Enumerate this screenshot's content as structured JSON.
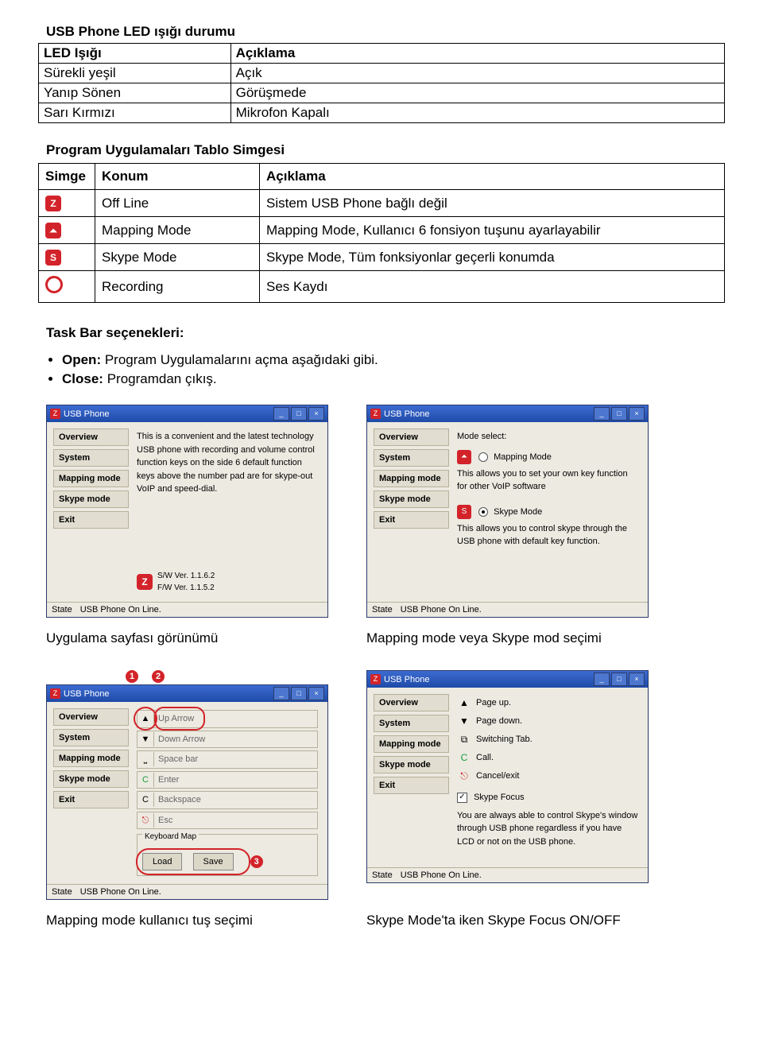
{
  "led_table": {
    "title": "USB Phone LED ışığı durumu",
    "header_left": "LED Işığı",
    "header_right": "Açıklama",
    "rows": [
      {
        "l": "Sürekli yeşil",
        "r": "Açık"
      },
      {
        "l": "Yanıp Sönen",
        "r": "Görüşmede"
      },
      {
        "l": "Sarı Kırmızı",
        "r": "Mikrofon Kapalı"
      }
    ]
  },
  "sim_table": {
    "title": "Program Uygulamaları Tablo Simgesi",
    "h1": "Simge",
    "h2": "Konum",
    "h3": "Açıklama",
    "rows": [
      {
        "icon": "Z",
        "konum": "Off Line",
        "acik": "Sistem USB Phone bağlı değil"
      },
      {
        "icon": "⏶",
        "konum": "Mapping Mode",
        "acik": "Mapping Mode, Kullanıcı 6 fonsiyon tuşunu ayarlayabilir"
      },
      {
        "icon": "S",
        "konum": "Skype Mode",
        "acik": "Skype Mode, Tüm fonksiyonlar geçerli konumda"
      },
      {
        "icon": "ring",
        "konum": "Recording",
        "acik": "Ses Kaydı"
      }
    ]
  },
  "task": {
    "title": "Task Bar seçenekleri:",
    "open_label": "Open:",
    "open_text": " Program Uygulamalarını açma aşağıdaki gibi.",
    "close_label": "Close:",
    "close_text": " Programdan çıkış."
  },
  "win_common": {
    "title": "USB Phone",
    "menu": [
      "Overview",
      "System",
      "Mapping mode",
      "Skype mode",
      "Exit"
    ],
    "state_label": "State",
    "state_value": "USB Phone On Line."
  },
  "shot1": {
    "overview_text": "This is a convenient and the latest technology USB phone with recording and volume control function keys on the side 6 default function keys above the number pad are for skype-out VoIP and speed-dial.",
    "sw_label": "S/W Ver.",
    "sw_value": "1.1.6.2",
    "fw_label": "F/W Ver.",
    "fw_value": "1.1.5.2"
  },
  "shot2": {
    "mode_select": "Mode select:",
    "mapping_label": "Mapping Mode",
    "mapping_desc": "This allows you to set your own key function for other VoIP software",
    "skype_label": "Skype Mode",
    "skype_desc": "This allows you to control skype through the USB phone with default key function."
  },
  "shot3": {
    "rows": [
      {
        "icon": "▲",
        "label": "Up Arrow"
      },
      {
        "icon": "▼",
        "label": "Down Arrow"
      },
      {
        "icon": "⎵",
        "label": "Space bar"
      },
      {
        "icon": "C",
        "label": "Enter",
        "green": true
      },
      {
        "icon": "C",
        "label": "Backspace"
      },
      {
        "icon": "⎋",
        "label": "Esc",
        "red": true
      }
    ],
    "kmap_label": "Keyboard Map",
    "load": "Load",
    "save": "Save",
    "badge1": "1",
    "badge2": "2",
    "badge3": "3"
  },
  "shot4": {
    "rows": [
      {
        "icon": "▲",
        "label": "Page up."
      },
      {
        "icon": "▼",
        "label": "Page down."
      },
      {
        "icon": "⧉",
        "label": "Switching Tab."
      },
      {
        "icon": "C",
        "label": "Call.",
        "green": true
      },
      {
        "icon": "⎋",
        "label": "Cancel/exit",
        "red": true
      }
    ],
    "focus_label": "Skype Focus",
    "focus_desc": "You are always able to control Skype's window through USB phone regardless if you have LCD or not on the USB phone."
  },
  "captions": {
    "c1": "Uygulama sayfası görünümü",
    "c2": "Mapping mode veya Skype mod seçimi",
    "c3": "Mapping mode kullanıcı tuş seçimi",
    "c4": "Skype Mode'ta iken Skype Focus ON/OFF"
  }
}
